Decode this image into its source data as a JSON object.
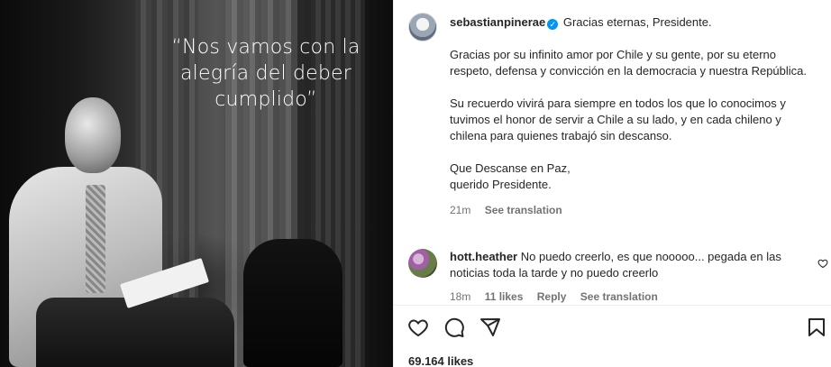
{
  "photo": {
    "quote_lines": [
      "“Nos vamos con la",
      "alegría del deber",
      "cumplido”"
    ]
  },
  "post": {
    "username": "sebastianpinerae",
    "verified_mark": "✓",
    "caption_first": "Gracias eternas, Presidente.",
    "paragraphs": [
      "Gracias por su infinito amor por Chile y su gente, por su eterno respeto, defensa y convicción en la democracia y nuestra República.",
      "Su recuerdo vivirá para siempre en todos los que lo conocimos y tuvimos el honor de servir a Chile a su lado, y en cada chileno y chilena para quienes trabajó sin descanso.",
      "Que Descanse en Paz,"
    ],
    "closing": "querido Presidente.",
    "time": "21m",
    "see_translation": "See translation"
  },
  "comment": {
    "username": "hott.heather",
    "text": "No puedo creerlo, es que nooooo... pegada en las noticias toda la tarde y no puedo creerlo",
    "time": "18m",
    "likes": "11 likes",
    "reply": "Reply",
    "see_translation": "See translation"
  },
  "icons": {
    "like": "heart-icon",
    "comment": "comment-icon",
    "share": "share-icon",
    "save": "bookmark-icon"
  },
  "footer": {
    "likes": "69.164 likes"
  }
}
